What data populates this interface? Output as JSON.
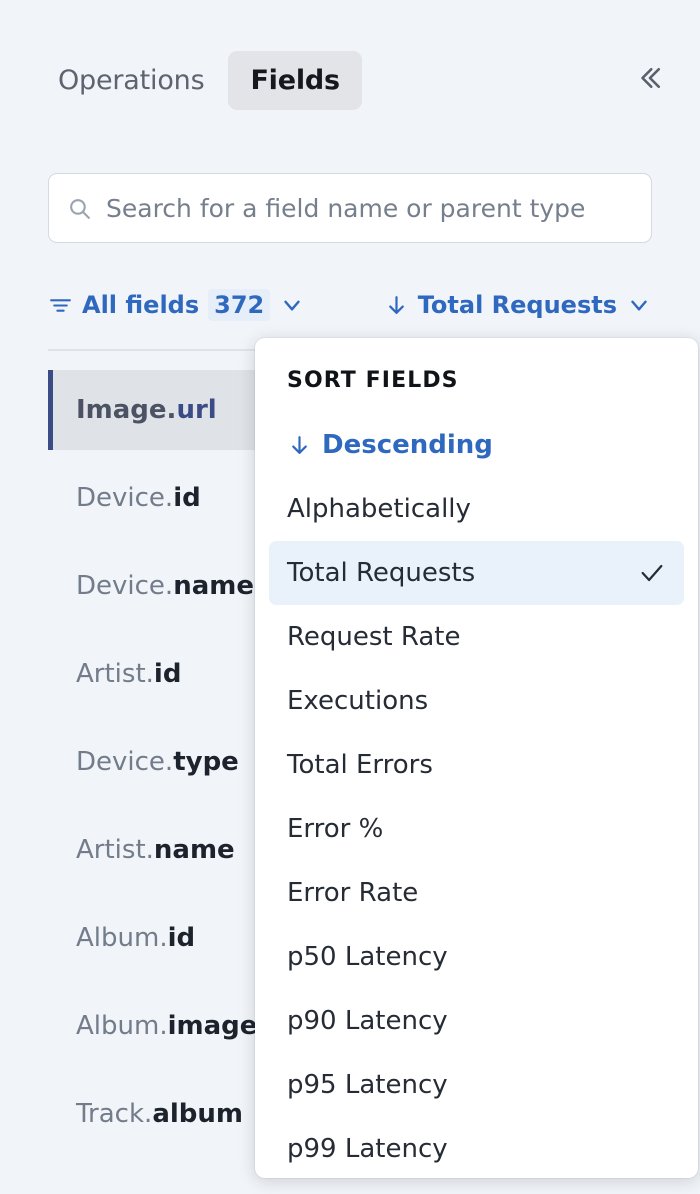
{
  "header": {
    "tabs": [
      {
        "label": "Operations",
        "active": false
      },
      {
        "label": "Fields",
        "active": true
      }
    ],
    "collapse_icon": "chevron-double-left-icon"
  },
  "search": {
    "icon": "search-icon",
    "placeholder": "Search for a field name or parent type",
    "value": ""
  },
  "filter_bar": {
    "filter_icon": "filter-icon",
    "filter_label": "All fields",
    "count": "372",
    "filter_chevron": "chevron-down-icon",
    "sort_arrow_icon": "arrow-down-icon",
    "sort_label": "Total Requests",
    "sort_chevron": "chevron-down-icon"
  },
  "field_list": [
    {
      "type": "Image",
      "name": "url",
      "selected": true
    },
    {
      "type": "Device",
      "name": "id",
      "selected": false
    },
    {
      "type": "Device",
      "name": "name",
      "selected": false
    },
    {
      "type": "Artist",
      "name": "id",
      "selected": false
    },
    {
      "type": "Device",
      "name": "type",
      "selected": false
    },
    {
      "type": "Artist",
      "name": "name",
      "selected": false
    },
    {
      "type": "Album",
      "name": "id",
      "selected": false
    },
    {
      "type": "Album",
      "name": "image",
      "selected": false
    },
    {
      "type": "Track",
      "name": "album",
      "selected": false
    }
  ],
  "sort_menu": {
    "title": "SORT FIELDS",
    "items": [
      {
        "label": "Descending",
        "accent": true,
        "icon": "arrow-down-icon",
        "selected": false
      },
      {
        "label": "Alphabetically",
        "accent": false,
        "selected": false
      },
      {
        "label": "Total Requests",
        "accent": false,
        "selected": true,
        "check": "check-icon"
      },
      {
        "label": "Request Rate",
        "accent": false,
        "selected": false
      },
      {
        "label": "Executions",
        "accent": false,
        "selected": false
      },
      {
        "label": "Total Errors",
        "accent": false,
        "selected": false
      },
      {
        "label": "Error %",
        "accent": false,
        "selected": false
      },
      {
        "label": "Error Rate",
        "accent": false,
        "selected": false
      },
      {
        "label": "p50 Latency",
        "accent": false,
        "selected": false
      },
      {
        "label": "p90 Latency",
        "accent": false,
        "selected": false
      },
      {
        "label": "p95 Latency",
        "accent": false,
        "selected": false
      },
      {
        "label": "p99 Latency",
        "accent": false,
        "selected": false
      }
    ]
  },
  "colors": {
    "background": "#f1f4f8",
    "accent": "#2f68bf",
    "selected_field_bar": "#3b4b86",
    "selected_field_bg": "#dfe2e7",
    "menu_selected_bg": "#e9f2fb",
    "tab_active_bg": "#e2e4e8"
  }
}
